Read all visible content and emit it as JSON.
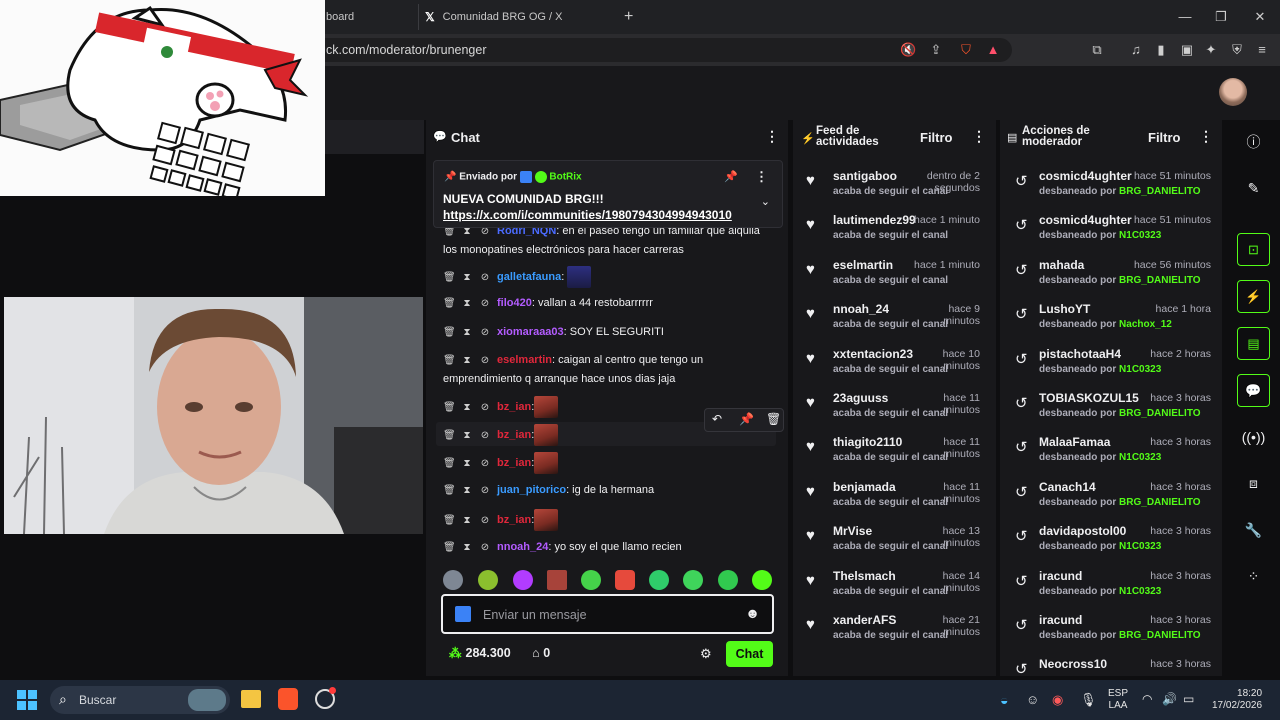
{
  "browser": {
    "tabs": [
      {
        "label": "board",
        "active": false
      },
      {
        "label": "Comunidad BRG OG / X",
        "active": false
      }
    ],
    "url": "ck.com/moderator/brunenger",
    "window_controls": [
      "minimize-icon",
      "restore-icon",
      "close-icon"
    ]
  },
  "chat": {
    "title": "Chat",
    "pinned": {
      "sent_by_label": "Enviado por",
      "bot_name": "BotRix",
      "line1": "NUEVA COMUNIDAD BRG!!!",
      "line2": "https://x.com/i/communities/1980794304994943010"
    },
    "messages": [
      {
        "user": "Rodri_NQN",
        "user_color": "#4b6bff",
        "text": ": en el paseo tengo un familiar que alquila los monopatines electrónicos para hacer carreras"
      },
      {
        "user": "galletafauna",
        "user_color": "#3a9bff",
        "text": ":",
        "emote": "tv"
      },
      {
        "user": "filo420",
        "user_color": "#b35cff",
        "text": ": vallan a 44 restobarrrrrr"
      },
      {
        "user": "xiomaraaa03",
        "user_color": "#b35cff",
        "text": ": SOY EL SEGURITI"
      },
      {
        "user": "eselmartin",
        "user_color": "#e0273b",
        "text": ": caigan al centro que tengo un emprendimiento q arranque hace unos dias jaja"
      },
      {
        "user": "bz_ian",
        "user_color": "#e0273b",
        "text": ":",
        "emote": "face"
      },
      {
        "user": "bz_ian",
        "user_color": "#e0273b",
        "text": ":",
        "emote": "face"
      },
      {
        "user": "bz_ian",
        "user_color": "#e0273b",
        "text": ":",
        "emote": "face"
      },
      {
        "user": "juan_pitorico",
        "user_color": "#3a9bff",
        "text": ": ig de la hermana"
      },
      {
        "user": "bz_ian",
        "user_color": "#e0273b",
        "text": ":",
        "emote": "face"
      },
      {
        "user": "nnoah_24",
        "user_color": "#b35cff",
        "text": ": yo soy el que llamo recien"
      }
    ],
    "input_placeholder": "Enviar un mensaje",
    "points": "284.300",
    "store_count": "0",
    "send_label": "Chat"
  },
  "activity_feed": {
    "title": "Feed de actividades",
    "filter_label": "Filtro",
    "items": [
      {
        "name": "santigaboo",
        "time": "dentro de 2 segundos",
        "desc": "acaba de seguir el canal"
      },
      {
        "name": "lautimendez99",
        "time": "hace 1 minuto",
        "desc": "acaba de seguir el canal"
      },
      {
        "name": "eselmartin",
        "time": "hace 1 minuto",
        "desc": "acaba de seguir el canal"
      },
      {
        "name": "nnoah_24",
        "time": "hace 9 minutos",
        "desc": "acaba de seguir el canal"
      },
      {
        "name": "xxtentacion23",
        "time": "hace 10 minutos",
        "desc": "acaba de seguir el canal"
      },
      {
        "name": "23aguuss",
        "time": "hace 11 minutos",
        "desc": "acaba de seguir el canal"
      },
      {
        "name": "thiagito2110",
        "time": "hace 11 minutos",
        "desc": "acaba de seguir el canal"
      },
      {
        "name": "benjamada",
        "time": "hace 11 minutos",
        "desc": "acaba de seguir el canal"
      },
      {
        "name": "MrVise",
        "time": "hace 13 minutos",
        "desc": "acaba de seguir el canal"
      },
      {
        "name": "Thelsmach",
        "time": "hace 14 minutos",
        "desc": "acaba de seguir el canal"
      },
      {
        "name": "xanderAFS",
        "time": "hace 21 minutos",
        "desc": "acaba de seguir el canal"
      }
    ]
  },
  "mod_actions": {
    "title": "Acciones de moderador",
    "filter_label": "Filtro",
    "desc_prefix": "desbaneado por",
    "items": [
      {
        "name": "cosmicd4ughter",
        "time": "hace 51 minutos",
        "by": "BRG_DANIELITO"
      },
      {
        "name": "cosmicd4ughter",
        "time": "hace 51 minutos",
        "by": "N1C0323"
      },
      {
        "name": "mahada",
        "time": "hace 56 minutos",
        "by": "BRG_DANIELITO"
      },
      {
        "name": "LushoYT",
        "time": "hace 1 hora",
        "by": "Nachox_12"
      },
      {
        "name": "pistachotaaH4",
        "time": "hace 2 horas",
        "by": "N1C0323"
      },
      {
        "name": "TOBIASKOZUL15",
        "time": "hace 3 horas",
        "by": "BRG_DANIELITO"
      },
      {
        "name": "MalaaFamaa",
        "time": "hace 3 horas",
        "by": "N1C0323"
      },
      {
        "name": "Canach14",
        "time": "hace 3 horas",
        "by": "BRG_DANIELITO"
      },
      {
        "name": "davidapostol00",
        "time": "hace 3 horas",
        "by": "N1C0323"
      },
      {
        "name": "iracund",
        "time": "hace 3 horas",
        "by": "N1C0323"
      },
      {
        "name": "iracund",
        "time": "hace 3 horas",
        "by": "BRG_DANIELITO"
      },
      {
        "name": "Neocross10",
        "time": "hace 3 horas",
        "by": ""
      }
    ]
  },
  "colors": {
    "accent": "#53fc18",
    "panel": "#18181b",
    "bg": "#0e0e10"
  },
  "taskbar": {
    "search_label": "Buscar",
    "lang": "ESP",
    "layout": "LAA",
    "time": "18:20",
    "date": "17/02/2026"
  }
}
